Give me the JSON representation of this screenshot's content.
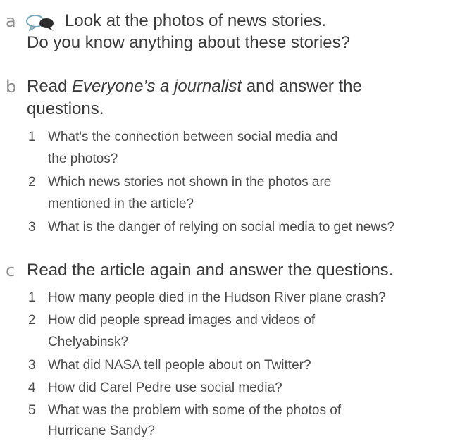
{
  "section_a": {
    "letter": "a",
    "icon": "speech-bubbles-icon",
    "line1": "Look at the photos of news stories.",
    "line2": "Do you know anything about these stories?"
  },
  "section_b": {
    "letter": "b",
    "instruction_pre": "Read ",
    "instruction_title": "Everyone’s a journalist",
    "instruction_post": " and answer the",
    "instruction_line2": "questions.",
    "questions": [
      {
        "num": "1",
        "lines": [
          "What's the connection between social media and",
          "the photos?"
        ]
      },
      {
        "num": "2",
        "lines": [
          "Which news stories not shown in the photos are",
          "mentioned in the article?"
        ]
      },
      {
        "num": "3",
        "lines": [
          "What is the danger of relying on social media to get news?"
        ]
      }
    ]
  },
  "section_c": {
    "letter": "c",
    "instruction": "Read the article again and answer the questions.",
    "questions": [
      {
        "num": "1",
        "lines": [
          "How many people died in the Hudson River plane crash?"
        ]
      },
      {
        "num": "2",
        "lines": [
          "How did people spread images and videos of",
          "Chelyabinsk?"
        ]
      },
      {
        "num": "3",
        "lines": [
          "What did NASA tell people about on Twitter?"
        ]
      },
      {
        "num": "4",
        "lines": [
          "How did Carel Pedre use social media?"
        ]
      },
      {
        "num": "5",
        "lines": [
          "What was the problem with some of the photos of",
          "Hurricane Sandy?"
        ]
      }
    ]
  }
}
